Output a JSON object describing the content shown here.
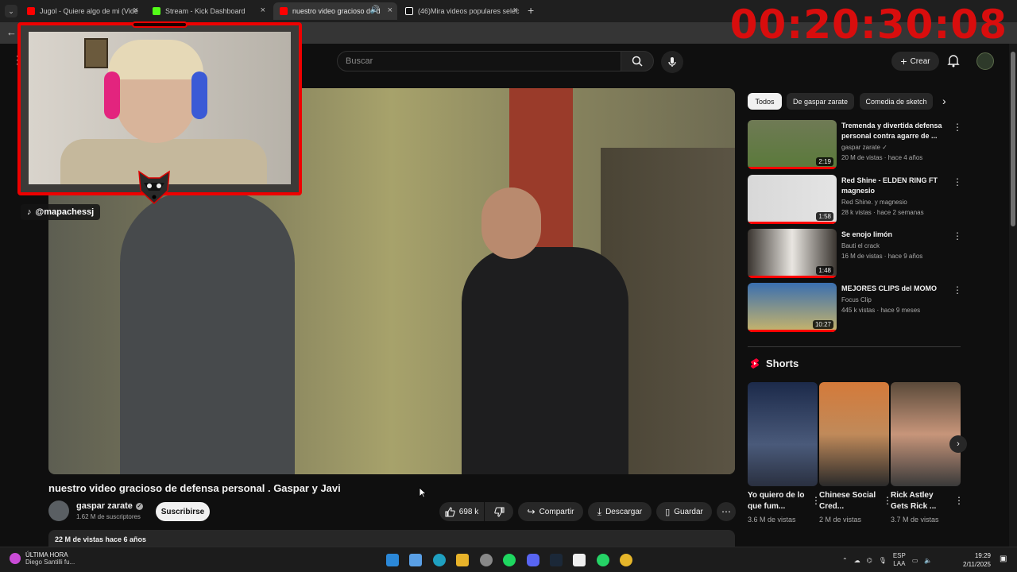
{
  "browser": {
    "tabs": [
      {
        "title": "Jugol - Quiere algo de mi (Vide",
        "favicon_color": "#ff0000"
      },
      {
        "title": "Stream - Kick Dashboard",
        "favicon_color": "#53fc18"
      },
      {
        "title": "nuestro video gracioso de d",
        "favicon_color": "#ff0000"
      },
      {
        "title": "(46)Mira videos populares selec",
        "favicon_color": "#ffffff"
      }
    ],
    "new_tab": "+"
  },
  "overlay": {
    "timer": "00:20:30:08",
    "tiktok_handle": "@mapachessj"
  },
  "header": {
    "search_placeholder": "Buscar",
    "create_label": "Crear"
  },
  "video": {
    "title": "nuestro video gracioso de defensa personal . Gaspar y Javi",
    "channel": "gaspar zarate",
    "subscribers": "1.62 M de suscriptores",
    "subscribe_label": "Suscribirse",
    "likes": "698 k",
    "share_label": "Compartir",
    "download_label": "Descargar",
    "save_label": "Guardar",
    "description": "22 M de vistas  hace 6 años"
  },
  "sidebar": {
    "chips": [
      "Todos",
      "De gaspar zarate",
      "Comedia de sketch"
    ],
    "recommendations": [
      {
        "title": "Tremenda y divertida defensa personal contra agarre de ...",
        "channel": "gaspar zarate",
        "meta": "20 M de vistas · hace 4 años",
        "duration": "2:19"
      },
      {
        "title": "Red Shine - ELDEN RING FT magnesio",
        "channel": "Red Shine. y magnesio",
        "meta": "28 k vistas · hace 2 semanas",
        "duration": "1:58"
      },
      {
        "title": "Se enojo limón",
        "channel": "Bauti el crack",
        "meta": "16 M de vistas · hace 9 años",
        "duration": "1:48"
      },
      {
        "title": "MEJORES CLIPS del MOMO",
        "channel": "Focus Clip",
        "meta": "445 k vistas · hace 9 meses",
        "duration": "10:27"
      }
    ],
    "shorts_heading": "Shorts",
    "shorts": [
      {
        "title": "Yo quiero de lo que fum...",
        "views": "3.6 M de vistas"
      },
      {
        "title": "Chinese Social Cred...",
        "views": "2 M de vistas"
      },
      {
        "title": "Rick Astley Gets Rick ...",
        "views": "3.7 M de vistas"
      }
    ]
  },
  "taskbar": {
    "news_title": "ÚLTIMA HORA",
    "news_sub": "Diego Santilli fu...",
    "lang1": "ESP",
    "lang2": "LAA",
    "time": "19:29",
    "date": "2/11/2025"
  }
}
